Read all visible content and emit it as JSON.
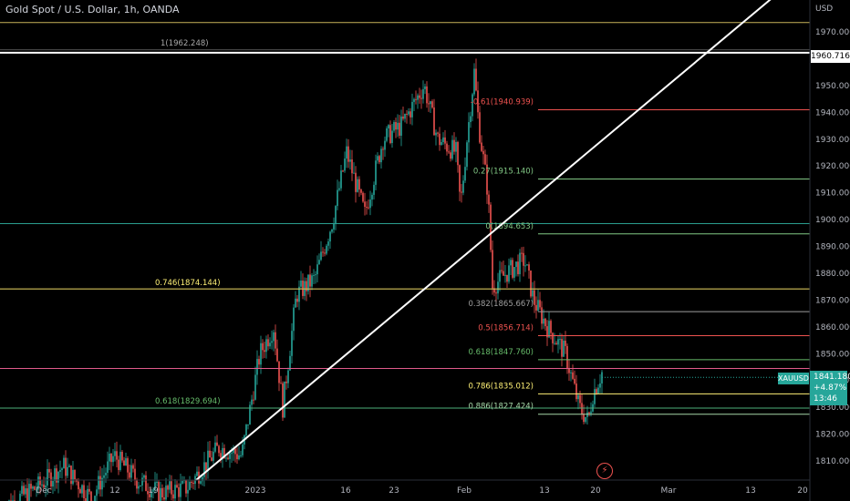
{
  "header": {
    "title": "Gold Spot / U.S. Dollar, 1h, OANDA",
    "currency": "USD"
  },
  "price_axis": {
    "labels": [
      "1970.000",
      "1960.000",
      "1950.000",
      "1940.000",
      "1930.000",
      "1920.000",
      "1910.000",
      "1900.000",
      "1890.000",
      "1880.000",
      "1870.000",
      "1860.000",
      "1850.000",
      "1840.000",
      "1830.000",
      "1820.000",
      "1810.000"
    ],
    "values": [
      1970,
      1960,
      1950,
      1940,
      1930,
      1920,
      1910,
      1900,
      1890,
      1880,
      1870,
      1860,
      1850,
      1840,
      1830,
      1820,
      1810
    ]
  },
  "time_axis": {
    "labels": [
      "Dec",
      "12",
      "19",
      "2023",
      "16",
      "23",
      "Feb",
      "13",
      "20",
      "Mar",
      "13",
      "20"
    ]
  },
  "horizontal_lines": {
    "top_yellow": {
      "value": 1973.5,
      "color": "#c8b45a"
    },
    "white_1962": {
      "label": "1(1962.248)",
      "value": 1962.248,
      "color": "#ffffff"
    },
    "teal_1898": {
      "value": 1898.5,
      "color": "#2a9d8f"
    },
    "yellow_0746": {
      "label": "0.746(1874.144)",
      "value": 1874.144,
      "color": "#d4c25a"
    },
    "pink_1845": {
      "value": 1844.5,
      "color": "#e05a8a"
    },
    "green_0618": {
      "label": "0.618(1829.694)",
      "value": 1829.694,
      "color": "#4caf7a"
    }
  },
  "fib_levels": [
    {
      "label": "-0.61(1940.939)",
      "value": 1940.939,
      "color": "#ef5350"
    },
    {
      "label": "0.27(1915.140)",
      "value": 1915.14,
      "color": "#81c784"
    },
    {
      "label": "0(1894.653)",
      "value": 1894.653,
      "color": "#81c784"
    },
    {
      "label": "0.382(1865.667)",
      "value": 1865.667,
      "color": "#9e9e9e"
    },
    {
      "label": "0.5(1856.714)",
      "value": 1856.714,
      "color": "#ef5350"
    },
    {
      "label": "0.618(1847.760)",
      "value": 1847.76,
      "color": "#66bb6a"
    },
    {
      "label": "0.786(1835.012)",
      "value": 1835.012,
      "color": "#fff176"
    },
    {
      "label": "0.886(1827.424)",
      "value": 1827.424,
      "color": "#a5d6a7"
    }
  ],
  "current_price": {
    "symbol": "XAUUSD",
    "price": "1841.180",
    "change": "+4.87%",
    "countdown": "13:46",
    "value": 1841.18
  },
  "white_price_tag": "1960.716",
  "colors": {
    "up": "#26a69a",
    "down": "#ef5350",
    "background": "#000000",
    "trendline": "#ffffff"
  },
  "icons": {
    "alert": "lightning-icon"
  }
}
